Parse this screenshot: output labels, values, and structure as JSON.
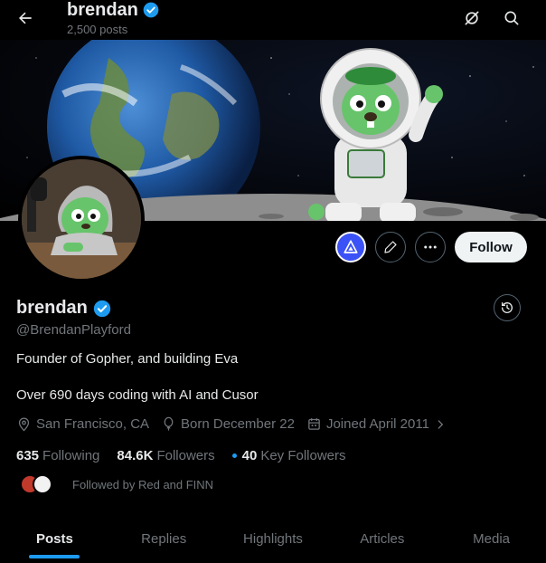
{
  "header": {
    "title": "brendan",
    "post_count": "2,500 posts"
  },
  "profile": {
    "display_name": "brendan",
    "handle": "@BrendanPlayford",
    "verified": true,
    "bio_line1": "Founder of Gopher, and building Eva",
    "bio_line2": "Over 690 days coding with AI and Cusor",
    "location": "San Francisco, CA",
    "birthday": "Born December 22",
    "joined": "Joined April 2011"
  },
  "stats": {
    "following_count": "635",
    "following_label": "Following",
    "followers_count": "84.6K",
    "followers_label": "Followers",
    "key_followers_count": "40",
    "key_followers_label": "Key Followers"
  },
  "followed_by": "Followed by Red and FINN",
  "actions": {
    "follow_label": "Follow"
  },
  "tabs": [
    {
      "label": "Posts",
      "active": true
    },
    {
      "label": "Replies",
      "active": false
    },
    {
      "label": "Highlights",
      "active": false
    },
    {
      "label": "Articles",
      "active": false
    },
    {
      "label": "Media",
      "active": false
    }
  ],
  "colors": {
    "accent": "#1d9bf0",
    "verified_badge": "#1d9bf0",
    "grok_button": "#3b52f6"
  }
}
